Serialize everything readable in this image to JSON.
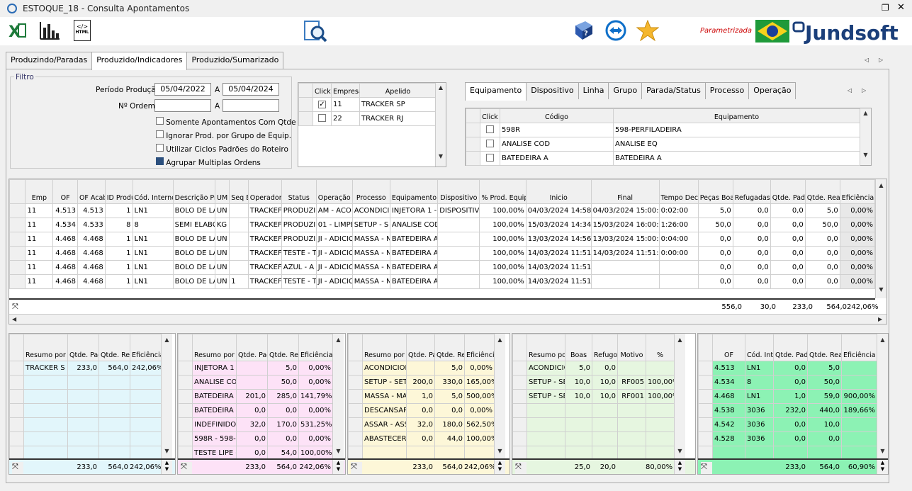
{
  "window": {
    "title": "ESTOQUE_18 - Consulta Apontamentos"
  },
  "toolbar": {
    "parametrizada": "Parametrizada",
    "brand": "Jundsoft"
  },
  "tabs": [
    "Produzindo/Paradas",
    "Produzido/Indicadores",
    "Produzido/Sumarizado"
  ],
  "filter": {
    "legend": "Filtro",
    "periodo_label": "Período Produção:",
    "date_from": "05/04/2022",
    "a1": "A",
    "date_to": "05/04/2024",
    "ordem_label": "Nº Ordem:",
    "a2": "A",
    "options": [
      {
        "label": "Somente Apontamentos Com Qtde",
        "checked": false
      },
      {
        "label": "Ignorar Prod. por Grupo de Equip.",
        "checked": false
      },
      {
        "label": "Utilizar Ciclos Padrões do Roteiro",
        "checked": false
      },
      {
        "label": "Agrupar Multiplas Ordens",
        "checked": true
      }
    ]
  },
  "empresas": {
    "headers": [
      "Click",
      "Empresa",
      "Apelido"
    ],
    "rows": [
      {
        "checked": true,
        "empresa": "11",
        "apelido": "TRACKER SP"
      },
      {
        "checked": false,
        "empresa": "22",
        "apelido": "TRACKER RJ"
      }
    ]
  },
  "equip_tabs": [
    "Equipamento",
    "Dispositivo",
    "Linha",
    "Grupo",
    "Parada/Status",
    "Processo",
    "Operação"
  ],
  "equip_grid": {
    "headers": [
      "Click",
      "Código",
      "Equipamento"
    ],
    "rows": [
      [
        "598R",
        "598-PERFILADEIRA"
      ],
      [
        "ANALISE COD",
        "ANALISE EQ"
      ],
      [
        "BATEDEIRA A",
        "BATEDEIRA A"
      ]
    ]
  },
  "main_grid": {
    "headers": [
      "Emp",
      "OF",
      "OF Acabado",
      "ID Produto",
      "Cód. Interno",
      "Descrição Produto",
      "UM",
      "Seq Exec",
      "Operador",
      "Status",
      "Operação",
      "Processo",
      "Equipamento",
      "Dispositivo",
      "% Prod. Equipamento",
      "Inicio",
      "Final",
      "Tempo Decorrido",
      "Peças Boas",
      "Refugadas",
      "Qtde. Padrão",
      "Qtde. Real",
      "Eficiência"
    ],
    "rows": [
      [
        "11",
        "4.513",
        "4.513",
        "1",
        "LN1",
        "BOLO DE LA",
        "UN",
        "",
        "TRACKEF",
        "PRODUZI",
        "AM - ACO",
        "ACONDICI",
        "INJETORA 1 -",
        "DISPOSITIV",
        "100,00%",
        "04/03/2024 14:58:00",
        "04/03/2024 15:00:00",
        "0:02:00",
        "5,0",
        "0,0",
        "0,0",
        "5,0",
        "0,00%"
      ],
      [
        "11",
        "4.534",
        "4.533",
        "8",
        "8",
        "SEMI ELABC",
        "KG",
        "",
        "TRACKEF",
        "PRODUZI",
        "01 - LIMPE",
        "SETUP - S",
        "ANALISE COD",
        "",
        "100,00%",
        "15/03/2024 14:34:00",
        "15/03/2024 16:00:00",
        "1:26:00",
        "50,0",
        "0,0",
        "0,0",
        "50,0",
        "0,00%"
      ],
      [
        "11",
        "4.468",
        "4.468",
        "1",
        "LN1",
        "BOLO DE LA",
        "UN",
        "",
        "TRACKEF",
        "PRODUZI",
        "JI - ADICIC",
        "MASSA - N",
        "BATEDEIRA A",
        "",
        "100,00%",
        "13/03/2024 14:56:00",
        "13/03/2024 15:00:00",
        "0:04:00",
        "0,0",
        "0,0",
        "0,0",
        "0,0",
        "0,00%"
      ],
      [
        "11",
        "4.468",
        "4.468",
        "1",
        "LN1",
        "BOLO DE LA",
        "UN",
        "",
        "TRACKEF",
        "TESTE - T",
        "JI - ADICIC",
        "MASSA - N",
        "BATEDEIRA A",
        "",
        "100,00%",
        "14/03/2024 11:51:00",
        "14/03/2024 11:51:00",
        "0:00:00",
        "0,0",
        "0,0",
        "0,0",
        "0,0",
        "0,00%"
      ],
      [
        "11",
        "4.468",
        "4.468",
        "1",
        "LN1",
        "BOLO DE LA",
        "UN",
        "",
        "TRACKEF",
        "AZUL - A",
        "JI - ADICIC",
        "MASSA - N",
        "BATEDEIRA A",
        "",
        "100,00%",
        "14/03/2024 11:51:00",
        "",
        "",
        "0,0",
        "0,0",
        "0,0",
        "0,0",
        "0,00%"
      ],
      [
        "11",
        "4.468",
        "4.468",
        "1",
        "LN1",
        "BOLO DE LA",
        "UN",
        "1",
        "TRACKEF",
        "TESTE - T",
        "JI - ADICIC",
        "MASSA - N",
        "BATEDEIRA A",
        "",
        "100,00%",
        "14/03/2024 11:51:00",
        "",
        "",
        "0,0",
        "0,0",
        "0,0",
        "0,0",
        "0,00%"
      ]
    ],
    "totals": [
      "556,0",
      "30,0",
      "233,0",
      "564,0",
      "242,06%"
    ]
  },
  "resumo_operador": {
    "headers": [
      "Resumo por Operador",
      "Qtde. Padrão",
      "Qtde. Real",
      "Eficiência"
    ],
    "rows": [
      [
        "TRACKER S",
        "233,0",
        "564,0",
        "242,06%"
      ]
    ],
    "totals": [
      "233,0",
      "564,0",
      "242,06%"
    ]
  },
  "resumo_equip": {
    "headers": [
      "Resumo por Equipamento",
      "Qtde. Padrão",
      "Qtde. Real",
      "Eficiência"
    ],
    "rows": [
      [
        "INJETORA 1",
        "",
        "5,0",
        "0,00%"
      ],
      [
        "ANALISE CO",
        "",
        "50,0",
        "0,00%"
      ],
      [
        "BATEDEIRA A",
        "201,0",
        "285,0",
        "141,79%"
      ],
      [
        "BATEDEIRA B",
        "0,0",
        "0,0",
        "0,00%"
      ],
      [
        "INDEFINIDO -",
        "32,0",
        "170,0",
        "531,25%"
      ],
      [
        "598R - 598-P",
        "0,0",
        "0,0",
        "0,00%"
      ],
      [
        "TESTE LIPE -",
        "0,0",
        "54,0",
        "100,00%"
      ]
    ],
    "totals": [
      "233,0",
      "564,0",
      "242,06%"
    ]
  },
  "resumo_processo": {
    "headers": [
      "Resumo por Processo",
      "Qtde. Padrão",
      "Qtde. Real",
      "Eficiência"
    ],
    "rows": [
      [
        "ACONDICION",
        "",
        "5,0",
        "0,00%"
      ],
      [
        "SETUP - SET",
        "200,0",
        "330,0",
        "165,00%"
      ],
      [
        "MASSA - MA",
        "1,0",
        "5,0",
        "500,00%"
      ],
      [
        "DESCANSAR",
        "0,0",
        "0,0",
        "0,00%"
      ],
      [
        "ASSAR - ASS",
        "32,0",
        "180,0",
        "562,50%"
      ],
      [
        "ABASTECER",
        "0,0",
        "44,0",
        "100,00%"
      ]
    ],
    "totals": [
      "233,0",
      "564,0",
      "242,06%"
    ]
  },
  "resumo_refugo": {
    "headers": [
      "Resumo por Refugo",
      "Boas",
      "Refugo",
      "Motivo",
      "%"
    ],
    "rows": [
      [
        "ACONDICIC",
        "5,0",
        "0,0",
        "",
        ""
      ],
      [
        "SETUP - SE",
        "10,0",
        "10,0",
        "RF005",
        "100,00%"
      ],
      [
        "SETUP - SE",
        "10,0",
        "10,0",
        "RF001",
        "100,00%"
      ]
    ],
    "totals": [
      "25,0",
      "20,0",
      "",
      "80,00%"
    ]
  },
  "resumo_of": {
    "headers": [
      "OF",
      "Cód. Interno",
      "Qtde. Padrão",
      "Qtde. Real",
      "Eficiência"
    ],
    "rows": [
      [
        "4.513",
        "LN1",
        "0,0",
        "5,0",
        ""
      ],
      [
        "4.534",
        "8",
        "0,0",
        "50,0",
        ""
      ],
      [
        "4.468",
        "LN1",
        "1,0",
        "59,0",
        "900,00%"
      ],
      [
        "4.538",
        "3036",
        "232,0",
        "440,0",
        "189,66%"
      ],
      [
        "4.542",
        "3036",
        "0,0",
        "10,0",
        ""
      ],
      [
        "4.528",
        "3036",
        "0,0",
        "0,0",
        ""
      ]
    ],
    "totals": [
      "233,0",
      "564,0",
      "60,90%"
    ]
  }
}
